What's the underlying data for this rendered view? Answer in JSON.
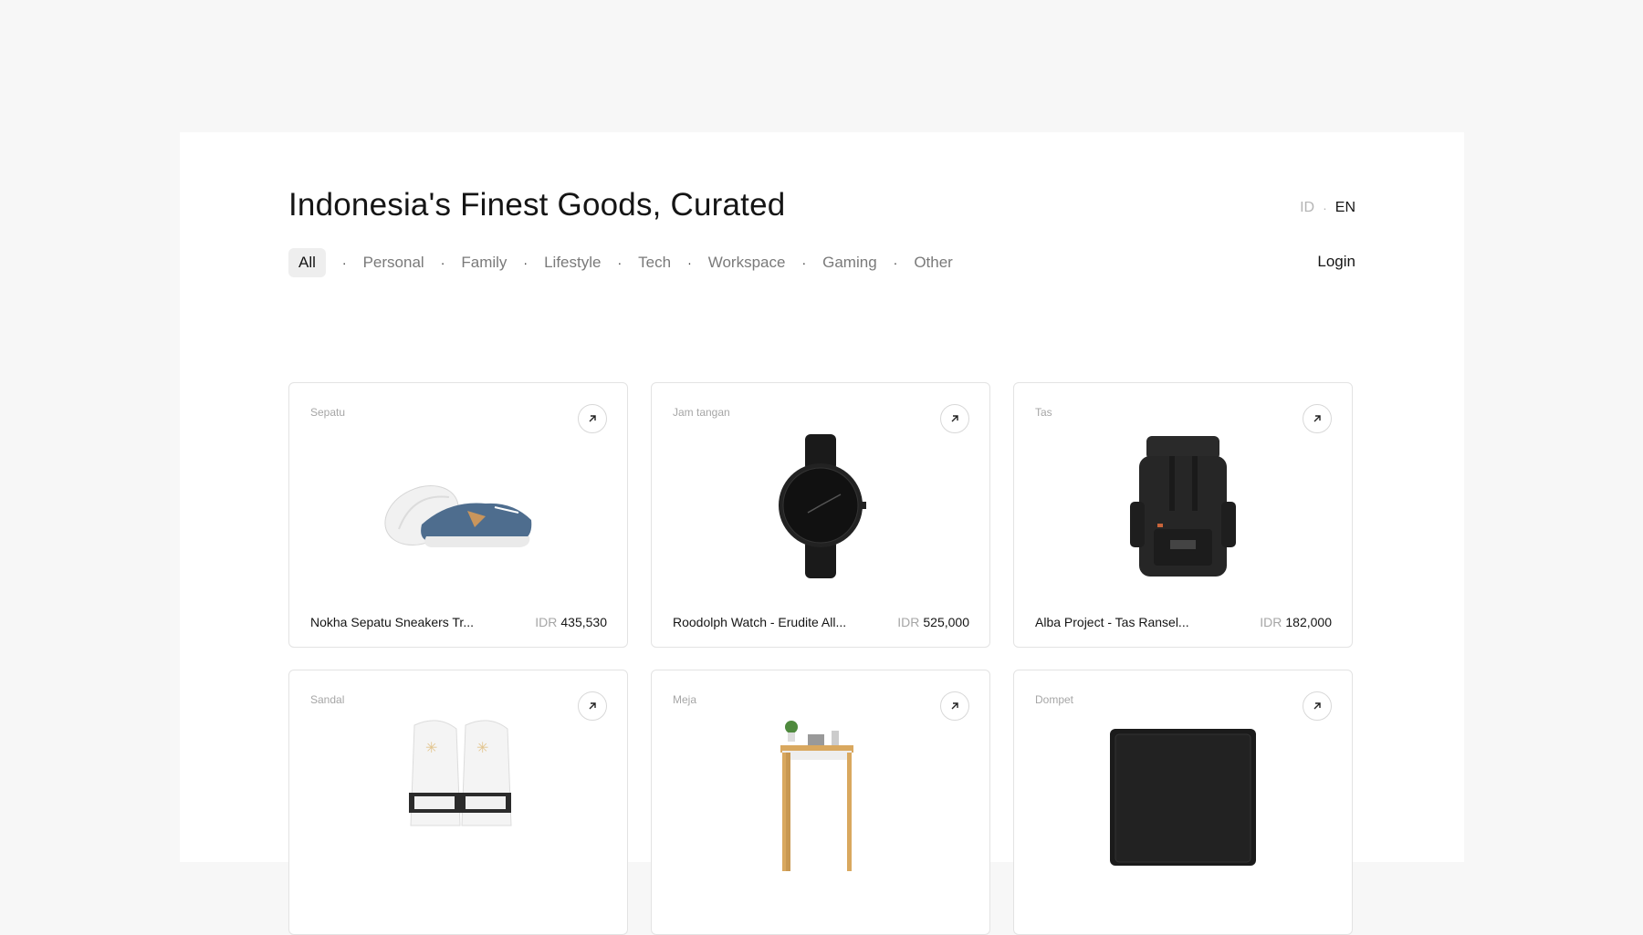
{
  "header": {
    "title": "Indonesia's Finest Goods, Curated",
    "lang_id": "ID",
    "lang_sep": "·",
    "lang_en": "EN"
  },
  "nav": {
    "items": [
      "All",
      "Personal",
      "Family",
      "Lifestyle",
      "Tech",
      "Workspace",
      "Gaming",
      "Other"
    ],
    "separator": "·",
    "login": "Login"
  },
  "products": [
    {
      "category": "Sepatu",
      "name": "Nokha Sepatu Sneakers Tr...",
      "currency": "IDR",
      "price": "435,530",
      "icon": "sneakers-image"
    },
    {
      "category": "Jam tangan",
      "name": "Roodolph Watch - Erudite All...",
      "currency": "IDR",
      "price": "525,000",
      "icon": "watch-image"
    },
    {
      "category": "Tas",
      "name": "Alba Project - Tas Ransel...",
      "currency": "IDR",
      "price": "182,000",
      "icon": "backpack-image"
    },
    {
      "category": "Sandal",
      "name": "",
      "currency": "",
      "price": "",
      "icon": "sandals-image"
    },
    {
      "category": "Meja",
      "name": "",
      "currency": "",
      "price": "",
      "icon": "desk-image"
    },
    {
      "category": "Dompet",
      "name": "",
      "currency": "",
      "price": "",
      "icon": "wallet-image"
    }
  ],
  "colors": {
    "background": "#f7f7f7",
    "panel": "#ffffff",
    "active_chip": "#eeeeee",
    "muted_text": "#a6a6a6"
  }
}
